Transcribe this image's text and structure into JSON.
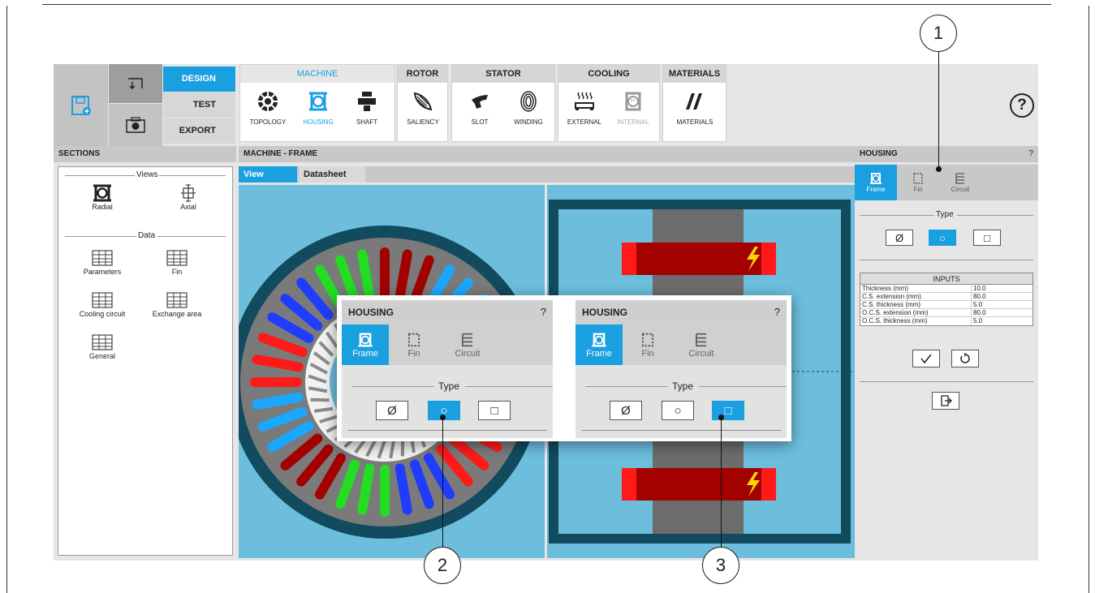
{
  "toolbar": {
    "modes": [
      {
        "label": "DESIGN",
        "active": true
      },
      {
        "label": "TEST",
        "active": false
      },
      {
        "label": "EXPORT",
        "active": false
      }
    ],
    "groups": {
      "machine": {
        "title": "MACHINE",
        "buttons": [
          "TOPOLOGY",
          "HOUSING",
          "SHAFT"
        ]
      },
      "rotor": {
        "title": "ROTOR",
        "buttons": [
          "SALIENCY"
        ]
      },
      "stator": {
        "title": "STATOR",
        "buttons": [
          "SLOT",
          "WINDING"
        ]
      },
      "cooling": {
        "title": "COOLING",
        "buttons": [
          "EXTERNAL",
          "INTERNAL"
        ]
      },
      "materials": {
        "title": "MATERIALS",
        "buttons": [
          "MATERIALS"
        ]
      }
    },
    "help": "?"
  },
  "sections": {
    "title": "SECTIONS",
    "views_label": "Views",
    "views": [
      "Radial",
      "Axial"
    ],
    "data_label": "Data",
    "data_items": [
      "Parameters",
      "Fin",
      "Cooling circuit",
      "Exchange area",
      "General"
    ]
  },
  "main": {
    "title": "MACHINE - FRAME",
    "tabs": [
      {
        "label": "View",
        "active": true
      },
      {
        "label": "Datasheet",
        "active": false
      }
    ]
  },
  "housing_panel": {
    "title": "HOUSING",
    "help": "?",
    "tabs": [
      "Frame",
      "Fin",
      "Circuit"
    ],
    "type_label": "Type",
    "type_options": [
      "Ø",
      "○",
      "□"
    ],
    "selected_type": 1,
    "inputs_title": "INPUTS",
    "inputs": [
      {
        "label": "Thickness (mm)",
        "value": "10.0"
      },
      {
        "label": "C.S. extension (mm)",
        "value": "80.0"
      },
      {
        "label": "C.S. thickness (mm)",
        "value": "5.0"
      },
      {
        "label": "O.C.S. extension (mm)",
        "value": "80.0"
      },
      {
        "label": "O.C.S. thickness (mm)",
        "value": "5.0"
      }
    ],
    "confirm_icon": "check-icon",
    "reset_icon": "undo-icon",
    "export_icon": "export-icon"
  },
  "popup": {
    "panels": [
      {
        "title": "HOUSING",
        "help": "?",
        "tabs": [
          "Frame",
          "Fin",
          "Circuit"
        ],
        "type_label": "Type",
        "type_options": [
          "Ø",
          "○",
          "□"
        ],
        "selected_type": 1
      },
      {
        "title": "HOUSING",
        "help": "?",
        "tabs": [
          "Frame",
          "Fin",
          "Circuit"
        ],
        "type_label": "Type",
        "type_options": [
          "Ø",
          "○",
          "□"
        ],
        "selected_type": 2
      }
    ]
  },
  "callouts": [
    "1",
    "2",
    "3"
  ],
  "colors": {
    "accent": "#1a9fe0",
    "canvas": "#6cbedc",
    "housing": "#124a5e",
    "conductor": "#a30000"
  }
}
